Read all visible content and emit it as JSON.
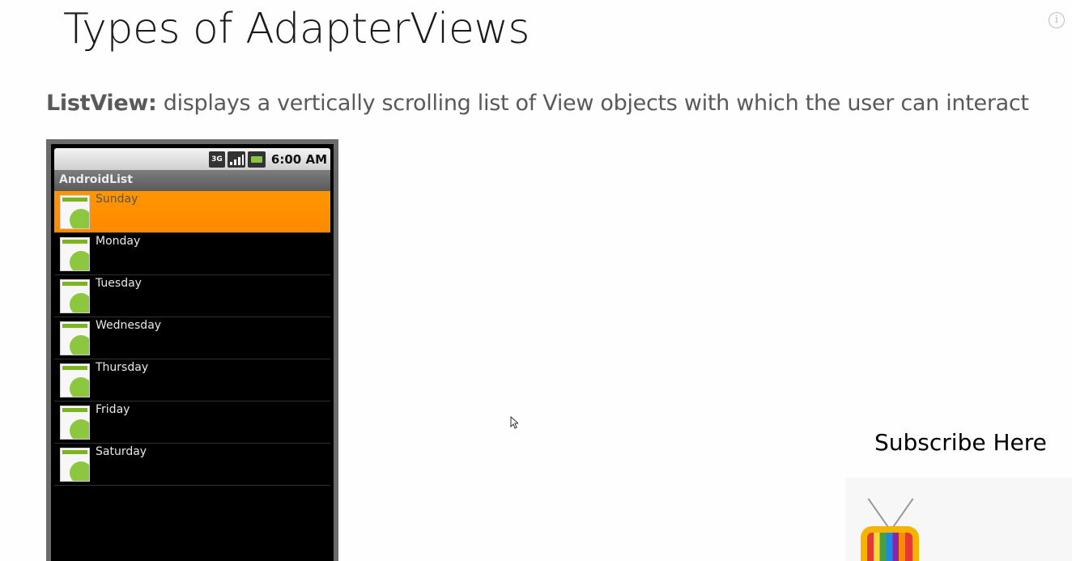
{
  "slide": {
    "title": "Types of AdapterViews",
    "info_glyph": "i",
    "description_term": "ListView:",
    "description_text": " displays a vertically scrolling list of View objects with which the user can interact"
  },
  "phone": {
    "status": {
      "network_label": "3G",
      "icons": [
        "3g-icon",
        "signal-icon",
        "battery-icon"
      ],
      "time": "6:00 AM"
    },
    "app_title": "AndroidList",
    "list_items": [
      "Sunday",
      "Monday",
      "Tuesday",
      "Wednesday",
      "Thursday",
      "Friday",
      "Saturday"
    ],
    "selected_index": 0,
    "colors": {
      "selected": "#ff8f00",
      "background": "#000000",
      "icon_green": "#8dc63f"
    }
  },
  "promo": {
    "subscribe_label": "Subscribe Here"
  }
}
